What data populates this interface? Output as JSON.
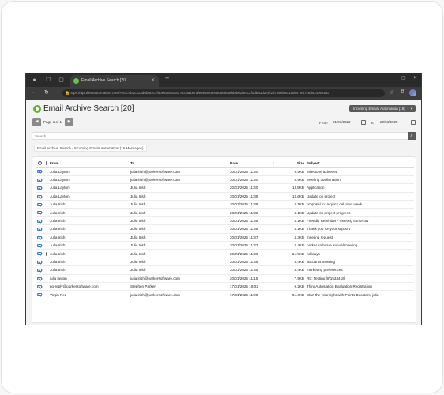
{
  "browser": {
    "tab_title": "Email Archive Search [20]",
    "url": "https://api.thinkautomation.com/#/57c4b2c313d0bf63c1f5be4d8d93a1 8cc4a1e7afe3e4e45ec8d8e6a5dd5b02f84c2f0dba1d2e5f2d7a98b6d15d847e47c9d4c4b6e1a3",
    "new_tab": "+",
    "icons": [
      "back-icon",
      "refresh-icon",
      "lock-icon",
      "favorites-icon",
      "collections-icon",
      "profile-icon"
    ]
  },
  "header": {
    "title": "Email Archive Search [20]",
    "dropdown_label": "Incoming Emails Automation [16]"
  },
  "pager": {
    "page_text": "Page 1 of 1",
    "from_label": "From",
    "from_date": "21/01/2022",
    "to_label": "To",
    "to_date": "20/01/2025"
  },
  "search": {
    "placeholder": "Search"
  },
  "breadcrumb": "Email Archive Search - Incoming Emails Automation (16 Messages)",
  "table": {
    "columns": {
      "from": "From",
      "to": "To",
      "date": "Date",
      "size": "Size",
      "subject": "Subject"
    },
    "rows": [
      {
        "from": "Julia Layton",
        "to": "julia.irish@parkersoftware.com",
        "date": "20/01/2025 11:40",
        "size": "9.5KB",
        "subject": "Milestone achieved",
        "attach": false
      },
      {
        "from": "Julia Layton",
        "to": "julia.irish@parkersoftware.com",
        "date": "20/01/2025 11:40",
        "size": "8.9KB",
        "subject": "Meeting confirmation",
        "attach": false
      },
      {
        "from": "Julia Layton",
        "to": "Julia Irish",
        "date": "20/01/2025 11:40",
        "size": "13.5KB",
        "subject": "Application",
        "attach": false
      },
      {
        "from": "Julia Layton",
        "to": "Julia Irish",
        "date": "20/01/2025 11:39",
        "size": "13.6KB",
        "subject": "Update on project",
        "attach": false
      },
      {
        "from": "Julia Irish",
        "to": "Julia Irish",
        "date": "20/01/2025 11:39",
        "size": "4.1KB",
        "subject": "proposal for a quick call next week",
        "attach": false
      },
      {
        "from": "Julia Irish",
        "to": "Julia Irish",
        "date": "20/01/2025 11:38",
        "size": "4.1KB",
        "subject": "Update on project progress",
        "attach": false
      },
      {
        "from": "Julia Irish",
        "to": "Julia Irish",
        "date": "20/01/2025 11:38",
        "size": "4.1KB",
        "subject": "Friendly Reminder - meeting tomorrow",
        "attach": false
      },
      {
        "from": "Julia Irish",
        "to": "Julia Irish",
        "date": "20/01/2025 11:38",
        "size": "4.1KB",
        "subject": "Thank you for your support",
        "attach": false
      },
      {
        "from": "Julia Irish",
        "to": "Julia Irish",
        "date": "20/01/2025 11:37",
        "size": "4.3KB",
        "subject": "meeting request",
        "attach": false
      },
      {
        "from": "Julia Irish",
        "to": "Julia Irish",
        "date": "20/01/2025 11:37",
        "size": "4.4KB",
        "subject": "parker software annual meeting",
        "attach": false
      },
      {
        "from": "Julia Irish",
        "to": "Julia Irish",
        "date": "20/01/2025 11:36",
        "size": "21.9KB",
        "subject": "holidays",
        "attach": true
      },
      {
        "from": "Julia Irish",
        "to": "Julia Irish",
        "date": "20/01/2025 11:36",
        "size": "4.4KB",
        "subject": "accounts meeting",
        "attach": false
      },
      {
        "from": "Julia Irish",
        "to": "Julia Irish",
        "date": "20/01/2025 11:35",
        "size": "4.4KB",
        "subject": "marketing preferences",
        "attach": false
      },
      {
        "from": "julia layton",
        "to": "julia.irish@parkersoftware.com",
        "date": "20/01/2025 11:15",
        "size": "7.5KB",
        "subject": "RE: Testing [8/1534416]",
        "attach": false
      },
      {
        "from": "no-reply@parkersoftware.com",
        "to": "Stephen Parker",
        "date": "17/01/2025 19:02",
        "size": "9.2KB",
        "subject": "ThinkAutomation Evaluation Registration",
        "attach": false
      },
      {
        "from": "Virgin Red",
        "to": "julia.irish@parkersoftware.com",
        "date": "17/01/2025 11:05",
        "size": "81.4KB",
        "subject": "Start the year right with Points Boosters, julia",
        "attach": false
      }
    ]
  }
}
